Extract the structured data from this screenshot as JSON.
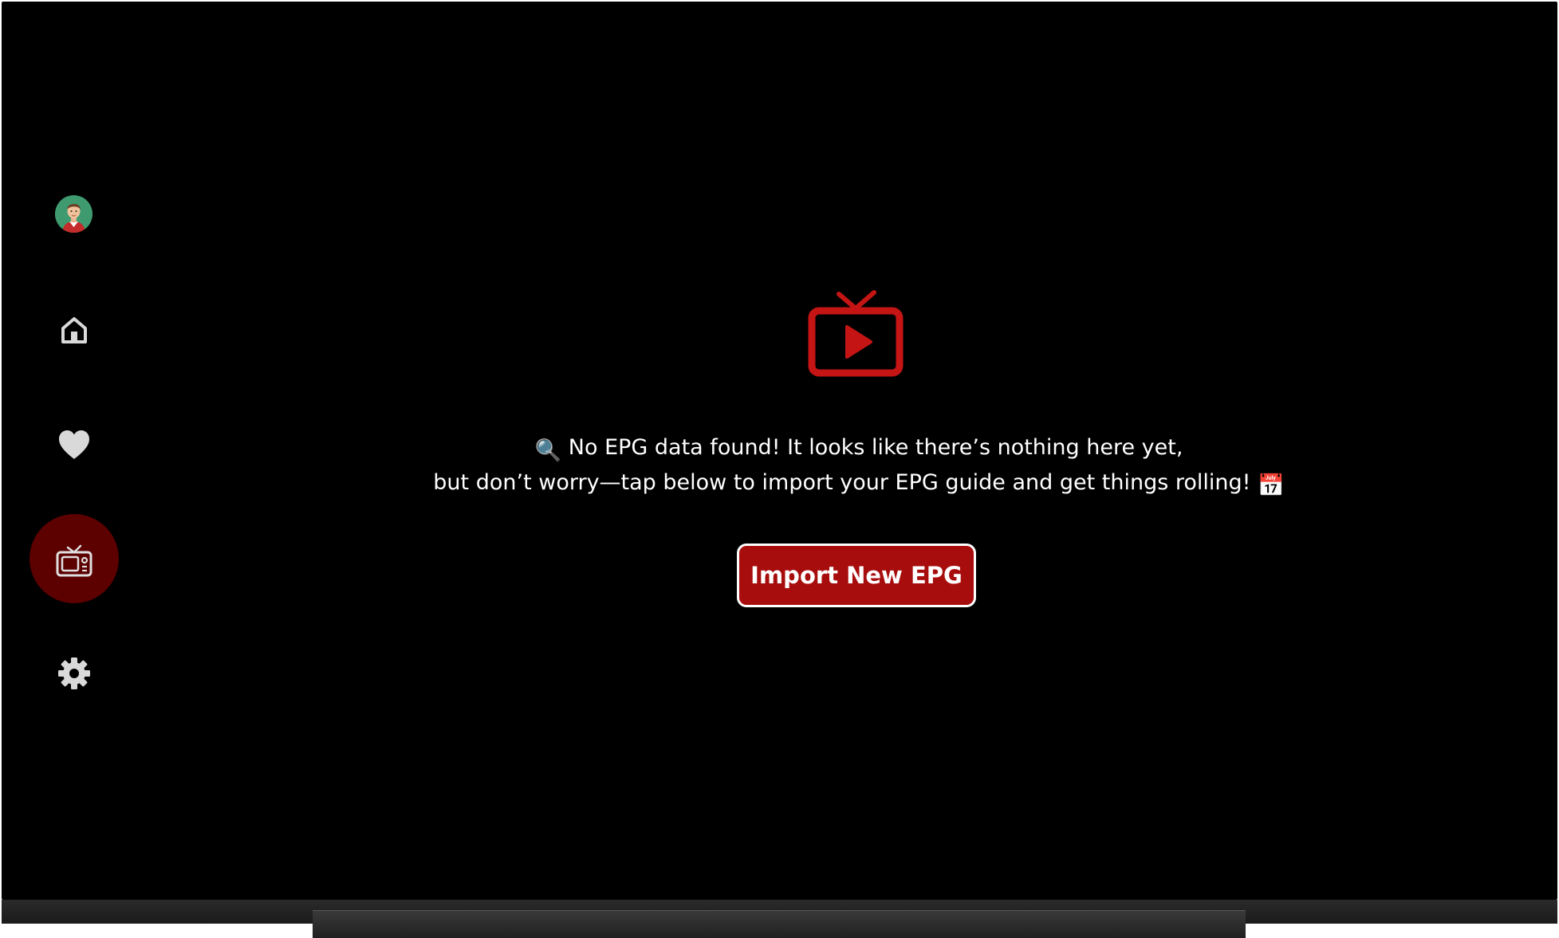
{
  "colors": {
    "background": "#000000",
    "accent": "#c41414",
    "active_nav": "#5c0000",
    "button": "#a80d0d",
    "icon": "#d9d9d9"
  },
  "sidebar": {
    "avatar": "profile-avatar",
    "items": [
      {
        "icon": "home-icon",
        "active": false
      },
      {
        "icon": "heart-icon",
        "active": false
      },
      {
        "icon": "tv-guide-icon",
        "active": true
      },
      {
        "icon": "gear-icon",
        "active": false
      }
    ]
  },
  "main": {
    "icon": "tv-play-icon",
    "message_line1_emoji": "🔍",
    "message_line1": "No EPG data found! It looks like there’s nothing here yet,",
    "message_line2": "but don’t worry—tap below to import your EPG guide and get things rolling!",
    "message_line2_emoji": "📅",
    "import_button_label": "Import New EPG"
  }
}
